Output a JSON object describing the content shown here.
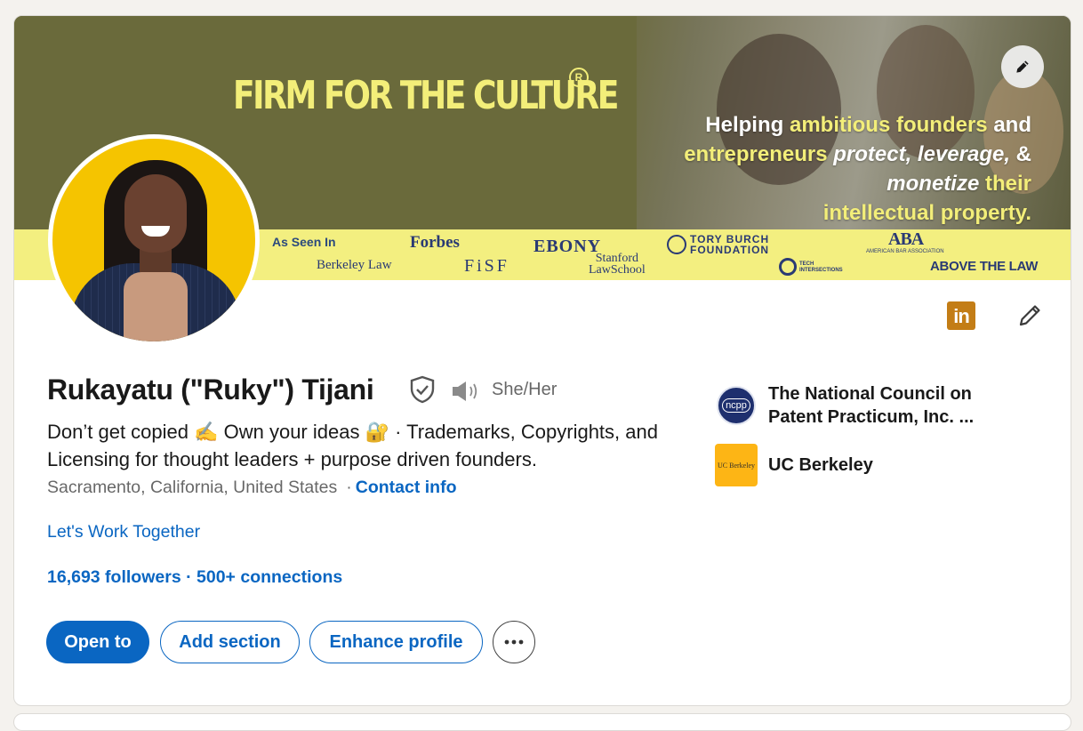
{
  "banner": {
    "firm_title": "FIRM FOR THE CULTURE",
    "registered_mark": "R",
    "tagline": {
      "l1a": "Helping ",
      "l1b": "ambitious founders",
      "l1c": " and",
      "l2a": "entrepreneurs",
      "l2b": " protect, leverage,",
      "l2c": " &",
      "l3a": "monetize",
      "l3b": " their",
      "l4": "intellectual property."
    },
    "press": {
      "as_seen_in": "As Seen In",
      "berkeley_law": "Berkeley Law",
      "forbes": "Forbes",
      "fisf": "FiSF",
      "ebony": "EBONY",
      "stanford_1": "Stanford",
      "stanford_2": "LawSchool",
      "tory_1": "TORY BURCH",
      "tory_2": "FOUNDATION",
      "aba": "ABA",
      "aba_sub": "AMERICAN BAR ASSOCIATION",
      "tech_1": "TECH",
      "tech_2": "INTERSECTIONS",
      "above_the_law": "ABOVE THE LAW"
    },
    "colors": {
      "olive": "#6b6a3c",
      "yellow": "#f3ee79",
      "navy": "#2a3a74"
    }
  },
  "profile": {
    "name": "Rukayatu (\"Ruky\") Tijani",
    "pronouns": "She/Her",
    "headline": "Don’t get copied ✍️ Own your ideas 🔐 · Trademarks, Copyrights, and Licensing for thought leaders + purpose driven founders.",
    "location": "Sacramento, California, United States",
    "separator": "·",
    "contact_info": "Contact info",
    "website_link": "Let's Work Together",
    "followers": "16,693 followers",
    "stats_separator": " · ",
    "connections": "500+ connections"
  },
  "header_icons": {
    "linkedin_badge": "in"
  },
  "buttons": {
    "open_to": "Open to",
    "add_section": "Add section",
    "enhance_profile": "Enhance profile"
  },
  "organizations": [
    {
      "name": "The National Council on Patent Practicum, Inc. ...",
      "logo_text": "ncpp",
      "icon": "ncpp-logo"
    },
    {
      "name": "UC Berkeley",
      "logo_text": "UC Berkeley",
      "icon": "uc-berkeley-logo"
    }
  ],
  "colors": {
    "link_blue": "#0a66c2",
    "linkedin_gold": "#c37d16",
    "page_bg": "#f4f2ee"
  }
}
